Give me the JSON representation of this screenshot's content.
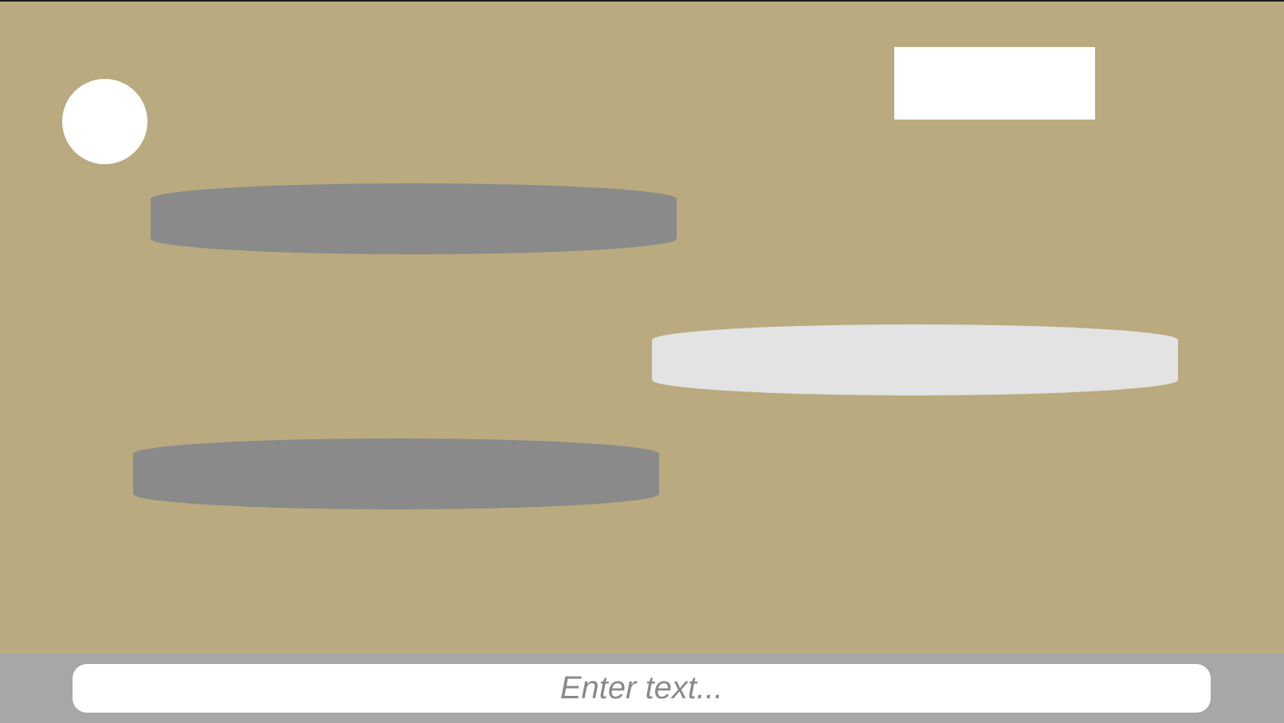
{
  "colors": {
    "chat_background": "#b9aa7f",
    "incoming_bubble": "#8a8a8a",
    "outgoing_bubble": "#e3e3e3",
    "input_bar": "#a7a7a7",
    "input_field": "#ffffff",
    "avatar": "#ffffff",
    "header_box": "#ffffff"
  },
  "chat": {
    "messages": [
      {
        "direction": "incoming",
        "text": ""
      },
      {
        "direction": "outgoing",
        "text": ""
      },
      {
        "direction": "incoming",
        "text": ""
      }
    ]
  },
  "composer": {
    "placeholder": "Enter text...",
    "value": ""
  }
}
